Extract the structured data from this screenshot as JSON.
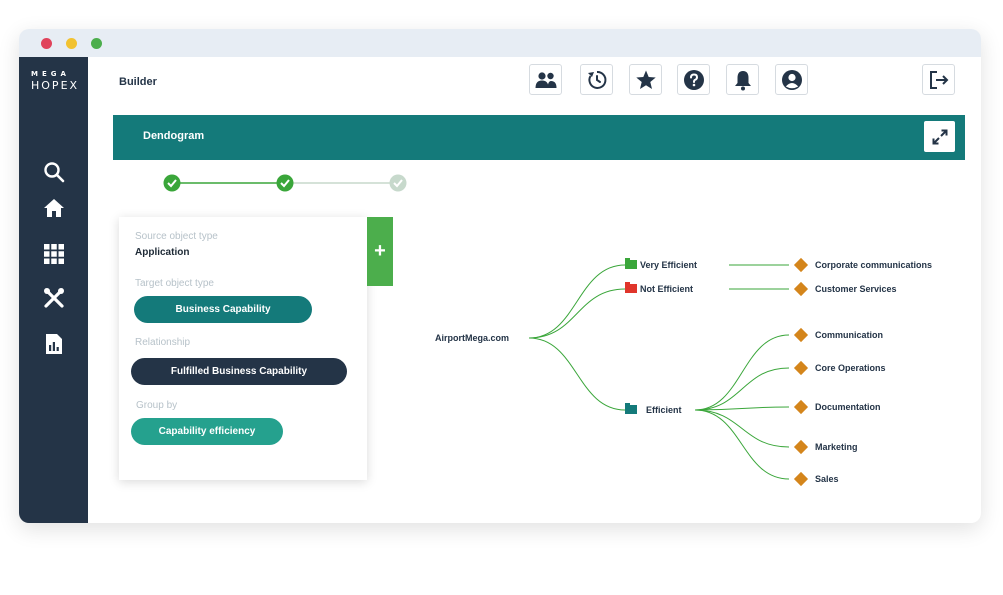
{
  "window": {
    "dots": {
      "close": "#e0435b",
      "minimize": "#f2c230",
      "maximize": "#4cae4c"
    }
  },
  "logo": {
    "line1": "MEGA",
    "line2": "HOPEX"
  },
  "sidebar": {
    "items": [
      {
        "icon": "search-icon"
      },
      {
        "icon": "home-icon"
      },
      {
        "icon": "grid-icon"
      },
      {
        "icon": "tools-icon"
      },
      {
        "icon": "report-icon"
      }
    ]
  },
  "header": {
    "title": "Builder",
    "toolbar": [
      "users-icon",
      "history-icon",
      "star-icon",
      "help-icon",
      "bell-icon",
      "profile-icon",
      "logout-icon"
    ]
  },
  "banner": {
    "title": "Dendogram",
    "color": "#147a7a"
  },
  "stepper": {
    "steps": [
      "done",
      "done",
      "pending"
    ],
    "done_color": "#3aa63a",
    "pending_color": "#c7d9cc"
  },
  "panel": {
    "source_label": "Source object type",
    "source_value": "Application",
    "target_label": "Target object type",
    "target_value": "Business Capability",
    "relationship_label": "Relationship",
    "relationship_value": "Fulfilled Business Capability",
    "group_label": "Group by",
    "group_value": "Capability efficiency",
    "add_label": "+"
  },
  "dendrogram": {
    "root": "AirportMega.com",
    "groups": [
      {
        "label": "Very Efficient",
        "color": "#3aa63a",
        "children": [
          "Corporate communications"
        ]
      },
      {
        "label": "Not Efficient",
        "color": "#e0352b",
        "children": [
          "Customer Services"
        ]
      },
      {
        "label": "Efficient",
        "color": "#147a7a",
        "children": [
          "Communication",
          "Core Operations",
          "Documentation",
          "Marketing",
          "Sales"
        ]
      }
    ],
    "leaf_color": "#d4851b",
    "link_color": "#3aa63a"
  }
}
